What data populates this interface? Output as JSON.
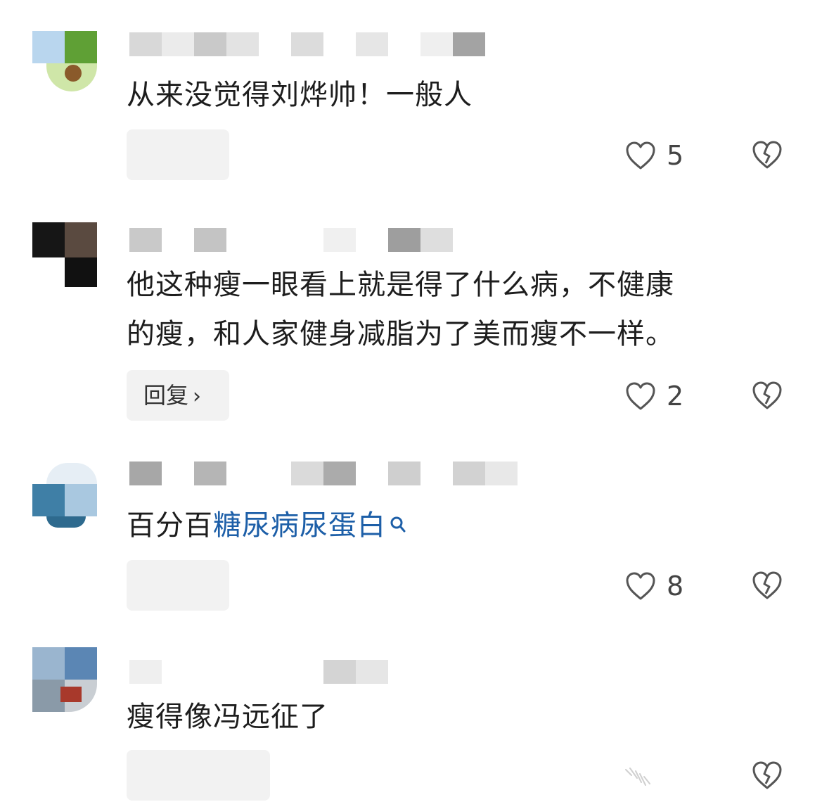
{
  "comments": [
    {
      "text": "从来没觉得刘烨帅！一般人",
      "reply_label": "",
      "likes": "5"
    },
    {
      "text_line1": "他这种瘦一眼看上就是得了什么病，不健康",
      "text_line2": "的瘦，和人家健身减脂为了美而瘦不一样。",
      "reply_label": "回复",
      "reply_chevron": "›",
      "likes": "2"
    },
    {
      "text_plain": "百分百",
      "text_link": "糖尿病尿蛋白",
      "reply_label": "",
      "likes": "8"
    },
    {
      "text": "瘦得像冯远征了",
      "reply_label": ""
    }
  ],
  "icons": {
    "like": "heart-outline-icon",
    "dislike": "broken-heart-icon",
    "search": "search-icon"
  },
  "colors": {
    "link": "#1d5fa8",
    "text": "#1d1d1d",
    "icon": "#555555",
    "button_bg": "#f2f2f2"
  }
}
